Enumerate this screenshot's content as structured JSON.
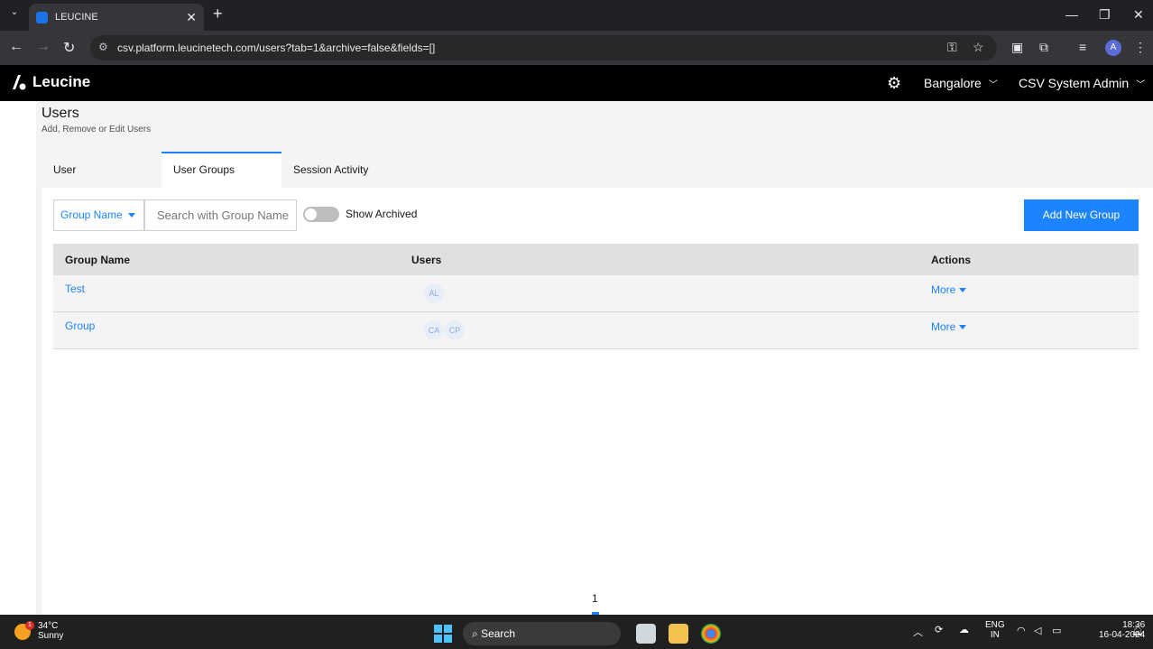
{
  "browser": {
    "tab_title": "LEUCINE",
    "url": "csv.platform.leucinetech.com/users?tab=1&archive=false&fields=[]",
    "profile_initial": "A"
  },
  "app": {
    "brand": "Leucine",
    "location": "Bangalore",
    "user_role": "CSV System Admin"
  },
  "page": {
    "title": "Users",
    "subtitle": "Add, Remove or Edit Users",
    "tabs": [
      {
        "label": "User",
        "active": false
      },
      {
        "label": "User Groups",
        "active": true
      },
      {
        "label": "Session Activity",
        "active": false
      }
    ]
  },
  "toolbar": {
    "filter_label": "Group Name",
    "search_placeholder": "Search with Group Name",
    "show_archived_label": "Show Archived",
    "show_archived_on": false,
    "add_button": "Add New Group"
  },
  "table": {
    "headers": [
      "Group Name",
      "Users",
      "Actions"
    ],
    "rows": [
      {
        "group_name": "Test",
        "users": [
          "AL"
        ],
        "action": "More"
      },
      {
        "group_name": "Group",
        "users": [
          "CA",
          "CP"
        ],
        "action": "More"
      }
    ]
  },
  "pagination": {
    "current_page": "1"
  },
  "taskbar": {
    "temperature": "34°C",
    "weather": "Sunny",
    "weather_badge": "1",
    "search_label": "Search",
    "lang_line1": "ENG",
    "lang_line2": "IN",
    "time": "18:36",
    "date": "16-04-2024"
  },
  "colors": {
    "accent": "#1d84ff",
    "app_bar": "#000000",
    "browser_chrome": "#202124"
  }
}
